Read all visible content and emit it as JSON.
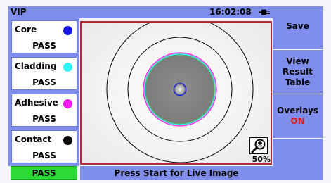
{
  "header": {
    "title": "VIP",
    "time": "16:02:08",
    "power_icon": "plug-icon"
  },
  "fibers": [
    {
      "label": "Core",
      "result": "PASS",
      "color": "#1515e0"
    },
    {
      "label": "Cladding",
      "result": "PASS",
      "color": "#33f4f4"
    },
    {
      "label": "Adhesive",
      "result": "PASS",
      "color": "#f019f0"
    },
    {
      "label": "Contact",
      "result": "PASS",
      "color": "#000000"
    }
  ],
  "overall_result": "PASS",
  "viewer": {
    "zoom_icon": "zoom-toggle-icon",
    "zoom_level": "50%",
    "frame_color": "#b22a35"
  },
  "status_message": "Press Start for Live Image",
  "softkeys": {
    "save": "Save",
    "view_result_table": [
      "View",
      "Result",
      "Table"
    ],
    "overlays_label": "Overlays",
    "overlays_value": "ON"
  },
  "colors": {
    "bar": "#7e8eea",
    "pass_green": "#2ddc38",
    "on_red": "#e21b1b"
  }
}
